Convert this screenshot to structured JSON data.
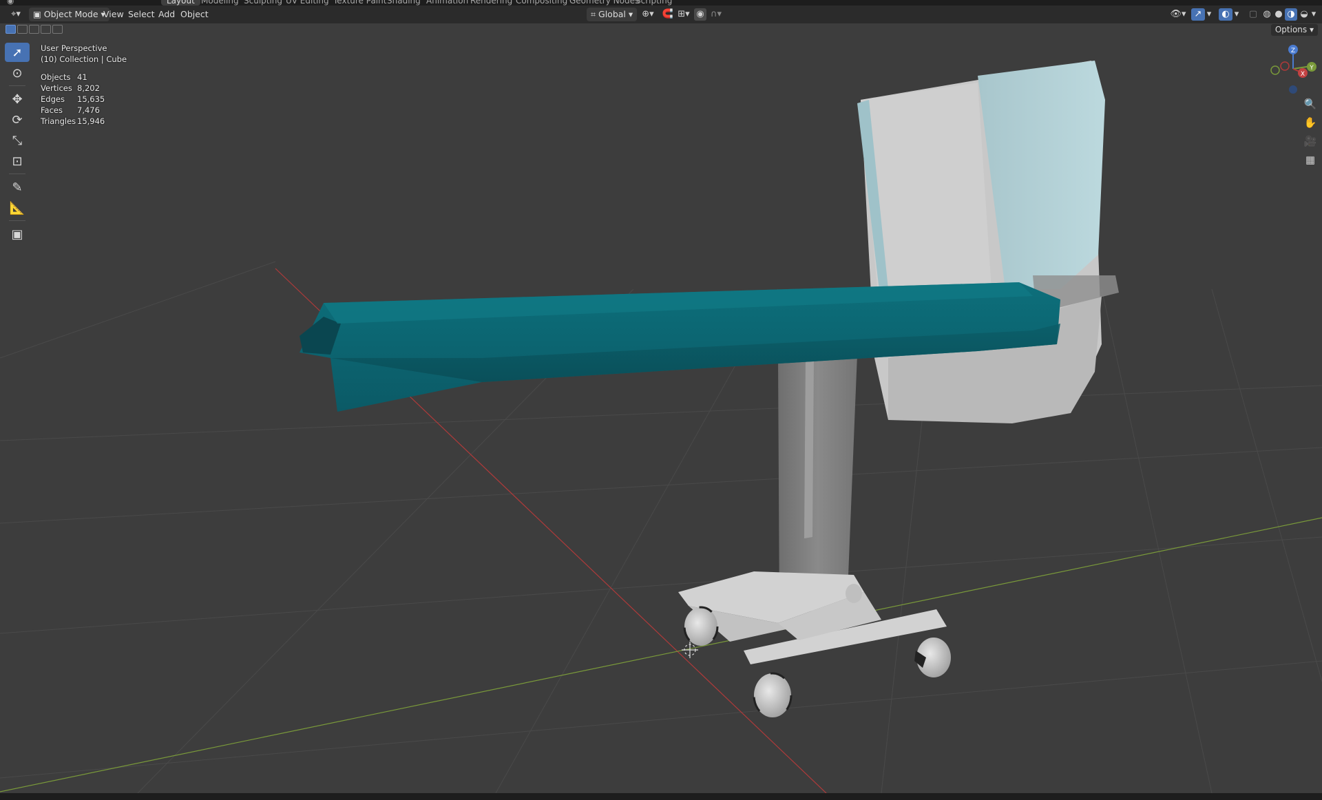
{
  "workspace_tabs": [
    "Layout",
    "Modeling",
    "Sculpting",
    "UV Editing",
    "Texture Paint",
    "Shading",
    "Animation",
    "Rendering",
    "Compositing",
    "Geometry Nodes",
    "Scripting"
  ],
  "workspace_active": "Layout",
  "header": {
    "mode": "Object Mode",
    "menus": [
      "View",
      "Select",
      "Add",
      "Object"
    ],
    "transform_orientation": "Global",
    "options": "Options"
  },
  "overlay": {
    "view_name": "User Perspective",
    "collection": "(10) Collection | Cube"
  },
  "stats": [
    {
      "label": "Objects",
      "value": "41"
    },
    {
      "label": "Vertices",
      "value": "8,202"
    },
    {
      "label": "Edges",
      "value": "15,635"
    },
    {
      "label": "Faces",
      "value": "7,476"
    },
    {
      "label": "Triangles",
      "value": "15,946"
    }
  ],
  "gizmo_axes": [
    "Z",
    "Y",
    "X"
  ],
  "tools": [
    "select-box",
    "cursor",
    "move",
    "rotate",
    "scale",
    "transform",
    "annotate",
    "measure",
    "add-cube"
  ],
  "colors": {
    "viewport_bg": "#3d3d3d",
    "accent": "#4772b3",
    "drape_teal": "#0e6b77",
    "axis_x": "#b03a3a",
    "axis_y": "#7a9a3a"
  }
}
